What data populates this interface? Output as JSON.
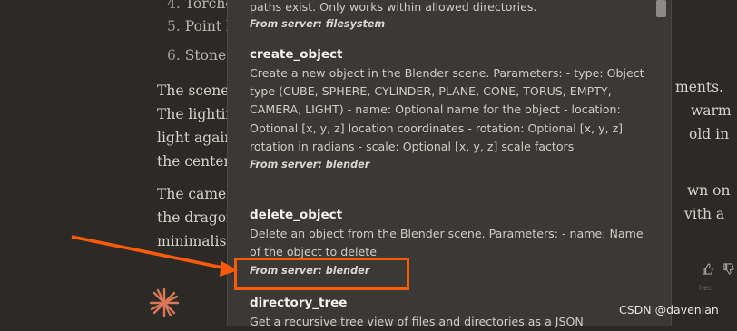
{
  "background": {
    "list_items": [
      {
        "num": "4.",
        "text": "Torche"
      },
      {
        "num": "5.",
        "text": "Point li"
      },
      {
        "num": "6.",
        "text": "Stone p"
      }
    ],
    "paragraph1_left": [
      "The scene",
      "The lightin",
      "light again",
      "the center"
    ],
    "paragraph1_right": [
      "ments.",
      "warm",
      "old in"
    ],
    "paragraph2_left": [
      "The camer",
      "the dragon",
      "minimalist"
    ],
    "paragraph2_right": [
      "wn on",
      "vith a"
    ]
  },
  "popup": {
    "intro_tail": "paths exist. Only works within allowed directories.",
    "intro_server": "From server: filesystem",
    "tools": [
      {
        "name": "create_object",
        "description": "Create a new object in the Blender scene. Parameters: - type: Object type (CUBE, SPHERE, CYLINDER, PLANE, CONE, TORUS, EMPTY, CAMERA, LIGHT) - name: Optional name for the object - location: Optional [x, y, z] location coordinates - rotation: Optional [x, y, z] rotation in radians - scale: Optional [x, y, z] scale factors",
        "server": "From server: blender"
      },
      {
        "name": "delete_object",
        "description": "Delete an object from the Blender scene. Parameters: - name: Name of the object to delete",
        "server": "From server: blender"
      },
      {
        "name": "directory_tree",
        "description": "Get a recursive tree view of files and directories as a JSON",
        "server": ""
      }
    ]
  },
  "annotation_color": "#ff5a0a",
  "footer": {
    "hint": "hec",
    "watermark": "CSDN @davenian"
  },
  "icons": [
    "thumbs-up-icon",
    "thumbs-down-icon",
    "sparkle-logo-icon"
  ]
}
